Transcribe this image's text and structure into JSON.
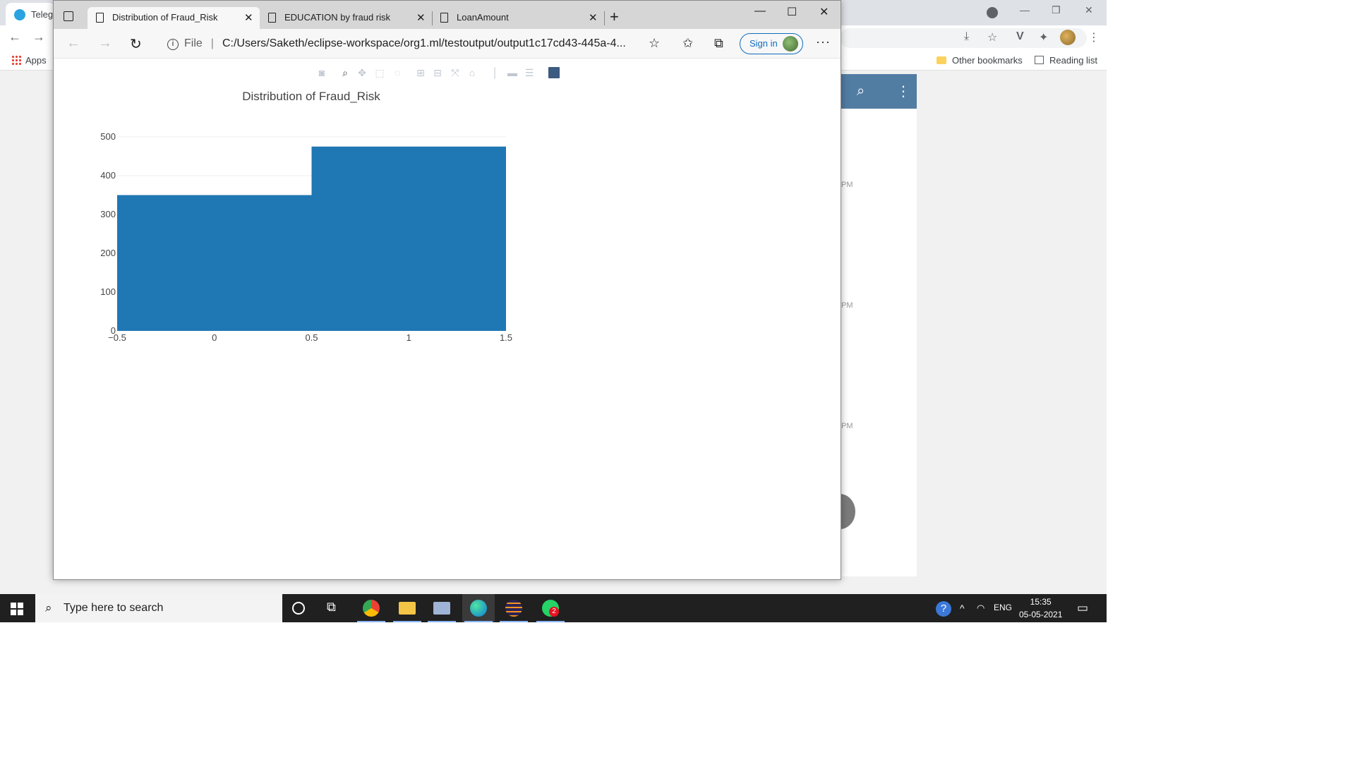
{
  "background_browser": {
    "tab_title": "Telegr",
    "bookmarks": {
      "apps": "Apps",
      "other": "Other bookmarks",
      "reading_list": "Reading list"
    },
    "side_times": [
      "PM",
      "PM",
      "PM"
    ]
  },
  "edge": {
    "tabs": [
      {
        "title": "Distribution of Fraud_Risk"
      },
      {
        "title": "EDUCATION by fraud risk"
      },
      {
        "title": "LoanAmount"
      }
    ],
    "address": {
      "scheme": "File",
      "url": "C:/Users/Saketh/eclipse-workspace/org1.ml/testoutput/output1c17cd43-445a-4..."
    },
    "sign_in": "Sign in"
  },
  "chart_data": {
    "type": "bar",
    "title": "Distribution of Fraud_Risk",
    "bins": [
      {
        "x0": -0.5,
        "x1": 0.5,
        "value": 350
      },
      {
        "x0": 0.5,
        "x1": 1.5,
        "value": 475
      }
    ],
    "xlim": [
      -0.5,
      1.5
    ],
    "ylim": [
      0,
      500
    ],
    "x_ticks": [
      -0.5,
      0,
      0.5,
      1,
      1.5
    ],
    "x_tick_labels": [
      "−0.5",
      "0",
      "0.5",
      "1",
      "1.5"
    ],
    "y_ticks": [
      0,
      100,
      200,
      300,
      400,
      500
    ],
    "y_tick_labels": [
      "0",
      "100",
      "200",
      "300",
      "400",
      "500"
    ],
    "bar_color": "#1f77b4",
    "grid": true
  },
  "taskbar": {
    "search_placeholder": "Type here to search",
    "language": "ENG",
    "time": "15:35",
    "date": "05-05-2021",
    "whatsapp_badge": "2"
  }
}
